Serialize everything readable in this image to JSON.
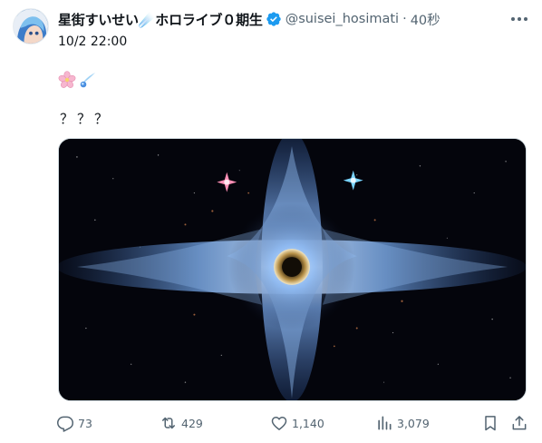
{
  "post": {
    "display_name": "星街すいせい☄️ホロライブ０期生",
    "handle": "@suisei_hosimati",
    "separator": "·",
    "relative_time": "40秒",
    "date": "10/2 22:00",
    "text": "？？？"
  },
  "icons": {
    "verified": "verified-badge-icon",
    "more": "more-options-icon",
    "emoji_1": "cherry-blossom-emoji",
    "emoji_2": "comet-emoji",
    "reply": "reply-icon",
    "repost": "repost-icon",
    "like": "like-icon",
    "views": "views-icon",
    "bookmark": "bookmark-icon",
    "share": "share-icon"
  },
  "stats": {
    "replies": "73",
    "reposts": "429",
    "likes": "1,140",
    "views": "3,079"
  },
  "colors": {
    "verified": "#1d9bf0",
    "text": "#0f1419",
    "secondary": "#536471",
    "border": "#cfd9de"
  }
}
